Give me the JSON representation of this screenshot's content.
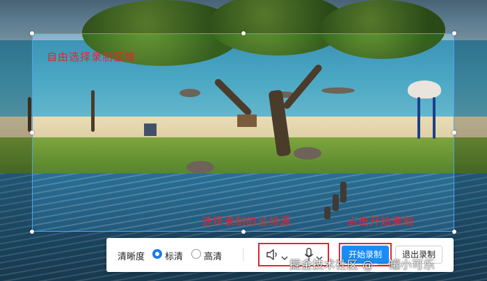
{
  "annotations": {
    "select_region": "自由选择录制区域",
    "select_audio": "选择录制的音频源",
    "click_start": "点击开始录制"
  },
  "toolbar": {
    "clarity_label": "清晰度",
    "options": [
      {
        "label": "标清",
        "selected": true
      },
      {
        "label": "高清",
        "selected": false
      }
    ],
    "speaker_icon": "speaker-icon",
    "mic_icon": "microphone-icon",
    "start_label": "开始录制",
    "exit_label": "退出录制"
  },
  "watermark": "掘金技术社区 @ 一罐小可乐",
  "colors": {
    "accent": "#1a8cf5",
    "annotation": "#e8242a",
    "selection_border": "#4aa3f0"
  }
}
